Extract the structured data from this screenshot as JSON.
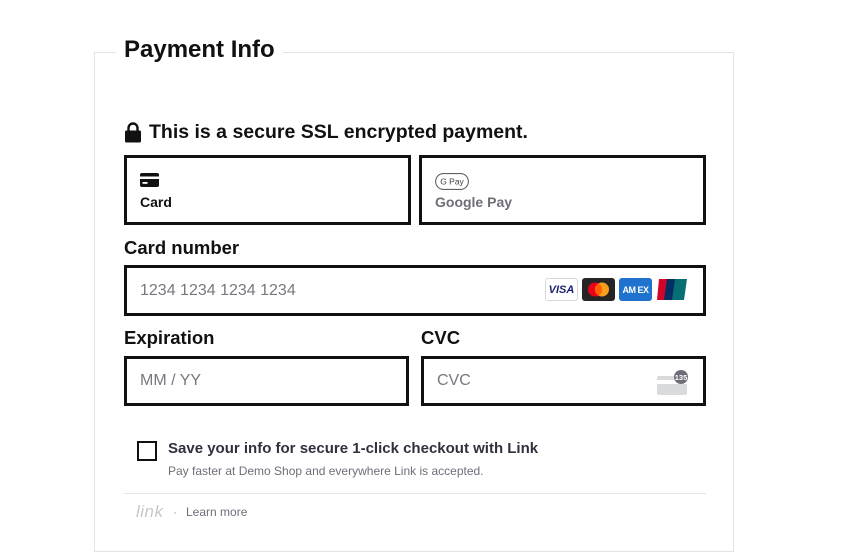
{
  "header": {
    "legend": "Payment Info",
    "secure_text": "This is a secure SSL encrypted payment."
  },
  "payment_methods": [
    {
      "id": "card",
      "label": "Card",
      "icon": "credit-card-icon",
      "selected": true
    },
    {
      "id": "google-pay",
      "label": "Google Pay",
      "icon": "google-pay-icon",
      "icon_text": "G Pay",
      "selected": false
    }
  ],
  "card_number": {
    "label": "Card number",
    "placeholder": "1234 1234 1234 1234",
    "brands": [
      {
        "name": "visa-icon",
        "text": "VISA"
      },
      {
        "name": "mastercard-icon"
      },
      {
        "name": "amex-icon",
        "text": "AM EX"
      },
      {
        "name": "unionpay-icon"
      }
    ]
  },
  "expiration": {
    "label": "Expiration",
    "placeholder": "MM / YY"
  },
  "cvc": {
    "label": "CVC",
    "placeholder": "CVC",
    "icon_text": "135"
  },
  "link": {
    "checkbox_checked": false,
    "title": "Save your info for secure 1-click checkout with Link",
    "subtitle": "Pay faster at Demo Shop and everywhere Link is accepted.",
    "logo_text": "link",
    "separator": "·",
    "learn_more": "Learn more"
  },
  "colors": {
    "border": "#111111",
    "placeholder": "#77787f",
    "muted": "#6d6e78",
    "fieldset_border": "#e3e3e3"
  }
}
